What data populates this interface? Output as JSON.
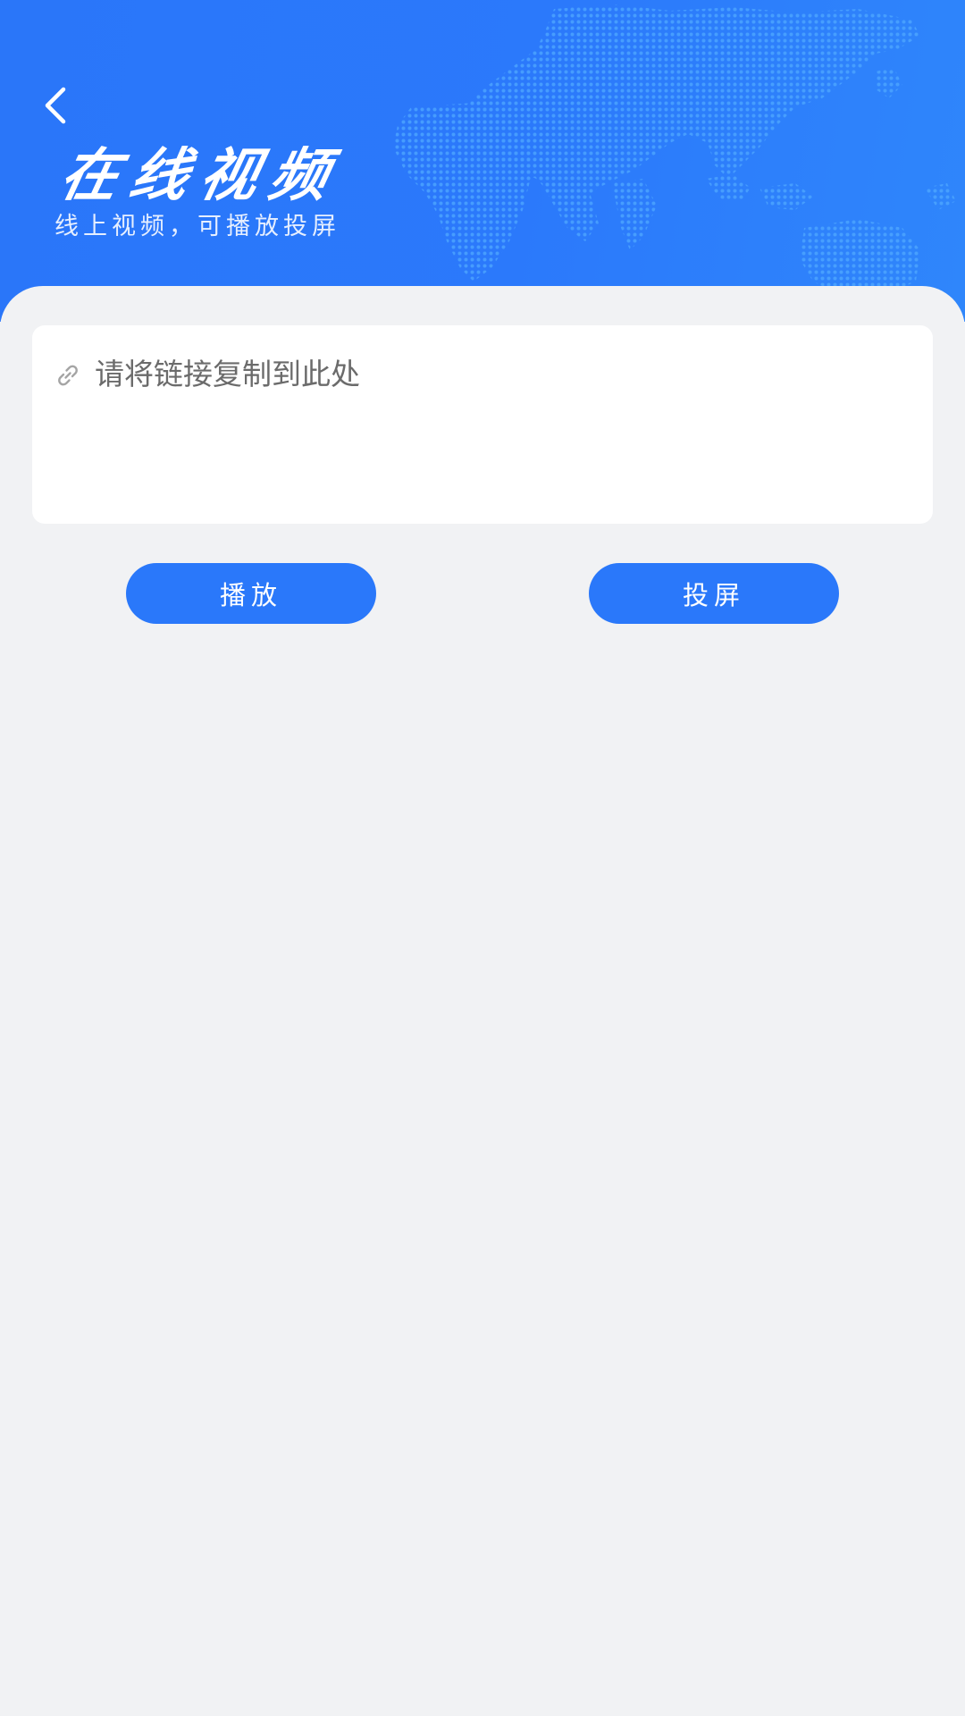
{
  "header": {
    "title": "在线视频",
    "subtitle": "线上视频，可播放投屏",
    "background_color": "#2a76f9",
    "back_icon": "chevron-left-icon"
  },
  "link_input": {
    "placeholder": "请将链接复制到此处",
    "value": "",
    "icon": "link-icon"
  },
  "actions": {
    "play_label": "播放",
    "cast_label": "投屏",
    "button_color": "#2a78fa"
  },
  "page": {
    "background_color": "#f1f2f4"
  }
}
